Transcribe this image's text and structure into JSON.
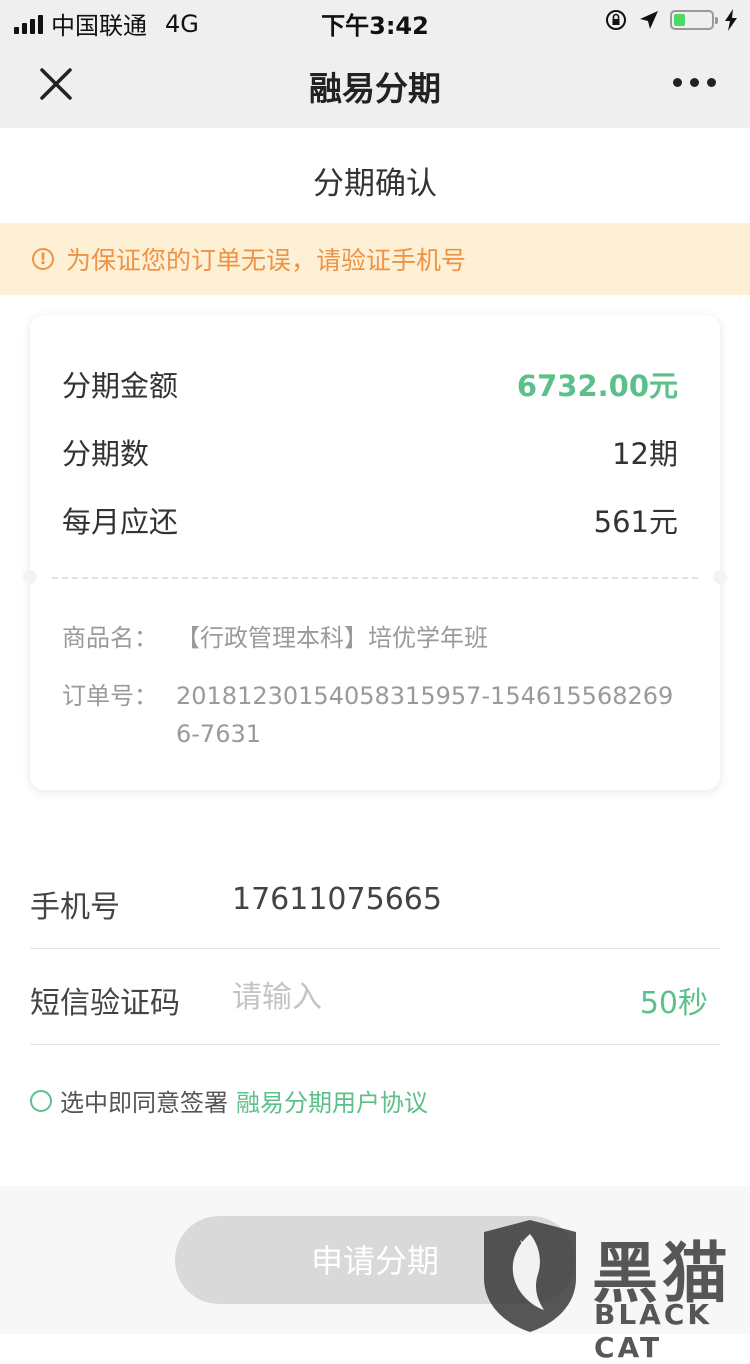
{
  "status_bar": {
    "carrier": "中国联通",
    "network": "4G",
    "time": "下午3:42",
    "battery_level": 0.3
  },
  "nav": {
    "title": "融易分期",
    "close_icon": "close-icon",
    "more_icon": "more-icon"
  },
  "page": {
    "subtitle": "分期确认"
  },
  "notice": {
    "icon": "!",
    "text": "为保证您的订单无误，请验证手机号"
  },
  "summary": {
    "amount_label": "分期金额",
    "amount_value": "6732.00元",
    "periods_label": "分期数",
    "periods_value": "12期",
    "monthly_label": "每月应还",
    "monthly_value": "561元",
    "product_label": "商品名：",
    "product_value": "【行政管理本科】培优学年班",
    "order_label": "订单号：",
    "order_value": "20181230154058315957-1546155682696-7631"
  },
  "form": {
    "phone_label": "手机号",
    "phone_value": "17611075665",
    "sms_label": "短信验证码",
    "sms_placeholder": "请输入",
    "countdown": "50秒"
  },
  "agreement": {
    "text": "选中即同意签署",
    "link": "融易分期用户协议"
  },
  "submit": {
    "label": "申请分期"
  },
  "watermark": {
    "cn": "黑猫",
    "en": "BLACK CAT"
  },
  "colors": {
    "accent_green": "#5cc08a",
    "notice_orange": "#ee9345",
    "notice_bg": "#fdf0d5"
  }
}
